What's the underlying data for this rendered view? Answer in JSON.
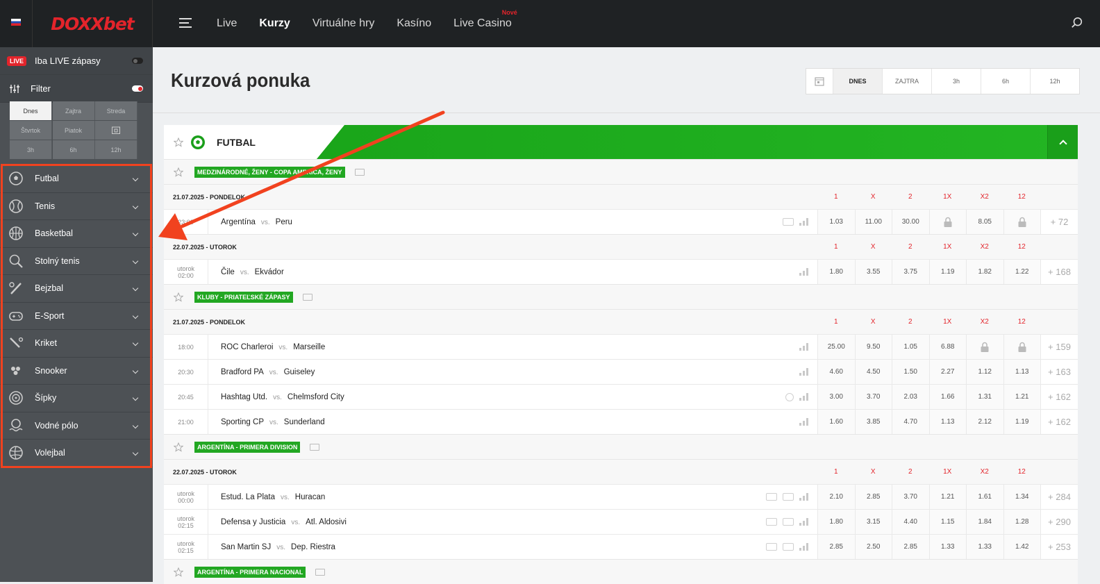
{
  "header": {
    "logo": "DOXXbet",
    "nav": [
      {
        "label": "Live",
        "active": false
      },
      {
        "label": "Kurzy",
        "active": true
      },
      {
        "label": "Virtuálne hry",
        "active": false
      },
      {
        "label": "Kasíno",
        "active": false
      },
      {
        "label": "Live Casino",
        "active": false,
        "badge": "Nové"
      }
    ]
  },
  "sidebar": {
    "live_badge": "LIVE",
    "live_only_label": "Iba LIVE zápasy",
    "filter_label": "Filter",
    "filter_days": [
      "Dnes",
      "Zajtra",
      "Streda",
      "Štvrtok",
      "Piatok",
      "",
      "3h",
      "6h",
      "12h"
    ],
    "sports": [
      {
        "label": "Futbal",
        "icon": "soccer-icon"
      },
      {
        "label": "Tenis",
        "icon": "tennis-icon"
      },
      {
        "label": "Basketbal",
        "icon": "basketball-icon"
      },
      {
        "label": "Stolný tenis",
        "icon": "table-tennis-icon"
      },
      {
        "label": "Bejzbal",
        "icon": "baseball-icon"
      },
      {
        "label": "E-Sport",
        "icon": "gamepad-icon"
      },
      {
        "label": "Kriket",
        "icon": "cricket-icon"
      },
      {
        "label": "Snooker",
        "icon": "snooker-icon"
      },
      {
        "label": "Šípky",
        "icon": "darts-icon"
      },
      {
        "label": "Vodné pólo",
        "icon": "water-polo-icon"
      },
      {
        "label": "Volejbal",
        "icon": "volleyball-icon"
      }
    ]
  },
  "main": {
    "title": "Kurzová ponuka",
    "day_tabs": [
      "DNES",
      "ZAJTRA",
      "3h",
      "6h",
      "12h"
    ],
    "sport_title": "FUTBAL",
    "odds_headers": [
      "1",
      "X",
      "2",
      "1X",
      "X2",
      "12"
    ],
    "sections": [
      {
        "league": "MEDZINÁRODNÉ, ŽENY - COPA AMERICA, ŽENY",
        "days": [
          {
            "date": "21.07.2025 - PONDELOK",
            "matches": [
              {
                "time": [
                  "23:00"
                ],
                "home": "Argentína",
                "away": "Peru",
                "icons": [
                  "tv",
                  "stats"
                ],
                "odds": [
                  "1.03",
                  "11.00",
                  "30.00",
                  "lock",
                  "8.05",
                  "lock"
                ],
                "more": "+ 72"
              }
            ]
          },
          {
            "date": "22.07.2025 - UTOROK",
            "matches": [
              {
                "time": [
                  "utorok",
                  "02:00"
                ],
                "home": "Čile",
                "away": "Ekvádor",
                "icons": [
                  "stats"
                ],
                "odds": [
                  "1.80",
                  "3.55",
                  "3.75",
                  "1.19",
                  "1.82",
                  "1.22"
                ],
                "more": "+ 168"
              }
            ]
          }
        ]
      },
      {
        "league": "KLUBY - PRIATEĽSKÉ ZÁPASY",
        "days": [
          {
            "date": "21.07.2025 - PONDELOK",
            "matches": [
              {
                "time": [
                  "18:00"
                ],
                "home": "ROC Charleroi",
                "away": "Marseille",
                "icons": [
                  "stats"
                ],
                "odds": [
                  "25.00",
                  "9.50",
                  "1.05",
                  "6.88",
                  "lock",
                  "lock"
                ],
                "more": "+ 159"
              },
              {
                "time": [
                  "20:30"
                ],
                "home": "Bradford PA",
                "away": "Guiseley",
                "icons": [
                  "stats"
                ],
                "odds": [
                  "4.60",
                  "4.50",
                  "1.50",
                  "2.27",
                  "1.12",
                  "1.13"
                ],
                "more": "+ 163"
              },
              {
                "time": [
                  "20:45"
                ],
                "home": "Hashtag Utd.",
                "away": "Chelmsford City",
                "icons": [
                  "clock",
                  "stats"
                ],
                "odds": [
                  "3.00",
                  "3.70",
                  "2.03",
                  "1.66",
                  "1.31",
                  "1.21"
                ],
                "more": "+ 162"
              },
              {
                "time": [
                  "21:00"
                ],
                "home": "Sporting CP",
                "away": "Sunderland",
                "icons": [
                  "stats"
                ],
                "odds": [
                  "1.60",
                  "3.85",
                  "4.70",
                  "1.13",
                  "2.12",
                  "1.19"
                ],
                "more": "+ 162"
              }
            ]
          }
        ]
      },
      {
        "league": "ARGENTÍNA - PRIMERA DIVISION",
        "days": [
          {
            "date": "22.07.2025 - UTOROK",
            "matches": [
              {
                "time": [
                  "utorok",
                  "00:00"
                ],
                "home": "Estud. La Plata",
                "away": "Huracan",
                "icons": [
                  "field",
                  "tv",
                  "stats"
                ],
                "odds": [
                  "2.10",
                  "2.85",
                  "3.70",
                  "1.21",
                  "1.61",
                  "1.34"
                ],
                "more": "+ 284"
              },
              {
                "time": [
                  "utorok",
                  "02:15"
                ],
                "home": "Defensa y Justicia",
                "away": "Atl. Aldosivi",
                "icons": [
                  "field",
                  "tv",
                  "stats"
                ],
                "odds": [
                  "1.80",
                  "3.15",
                  "4.40",
                  "1.15",
                  "1.84",
                  "1.28"
                ],
                "more": "+ 290"
              },
              {
                "time": [
                  "utorok",
                  "02:15"
                ],
                "home": "San Martin SJ",
                "away": "Dep. Riestra",
                "icons": [
                  "field",
                  "tv",
                  "stats"
                ],
                "odds": [
                  "2.85",
                  "2.50",
                  "2.85",
                  "1.33",
                  "1.33",
                  "1.42"
                ],
                "more": "+ 253"
              }
            ]
          }
        ]
      },
      {
        "league": "ARGENTÍNA - PRIMERA NACIONAL",
        "days": []
      }
    ]
  },
  "colors": {
    "accent_red": "#e3242b",
    "green": "#22a722",
    "annotation": "#f1421f"
  }
}
